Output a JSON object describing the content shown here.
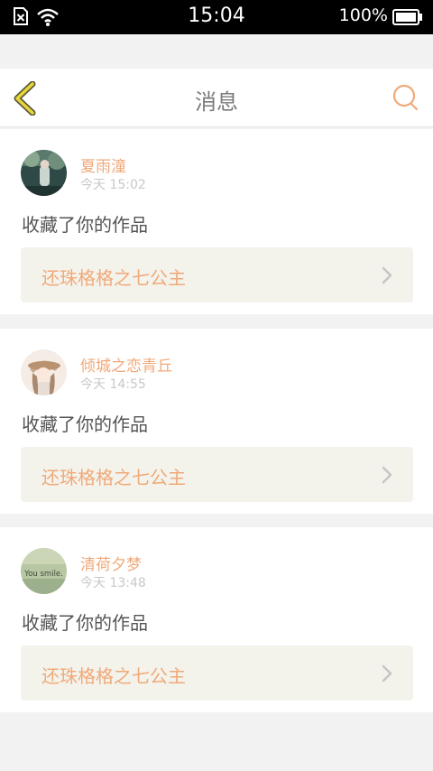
{
  "status_bar": {
    "time": "15:04",
    "battery": "100%"
  },
  "header": {
    "title": "消息",
    "back_icon": "chevron-left-icon",
    "search_icon": "search-icon"
  },
  "colors": {
    "accent": "#f0a979",
    "back_arrow": "#e8d63a",
    "work_bg": "#f3f3ec"
  },
  "messages": [
    {
      "user": "夏雨潼",
      "time": "今天  15:02",
      "action": "收藏了你的作品",
      "work_title": "还珠格格之七公主"
    },
    {
      "user": "倾城之恋青丘",
      "time": "今天  14:55",
      "action": "收藏了你的作品",
      "work_title": "还珠格格之七公主"
    },
    {
      "user": "清荷夕梦",
      "time": "今天  13:48",
      "action": "收藏了你的作品",
      "work_title": "还珠格格之七公主",
      "avatar_text": "You smile."
    }
  ]
}
